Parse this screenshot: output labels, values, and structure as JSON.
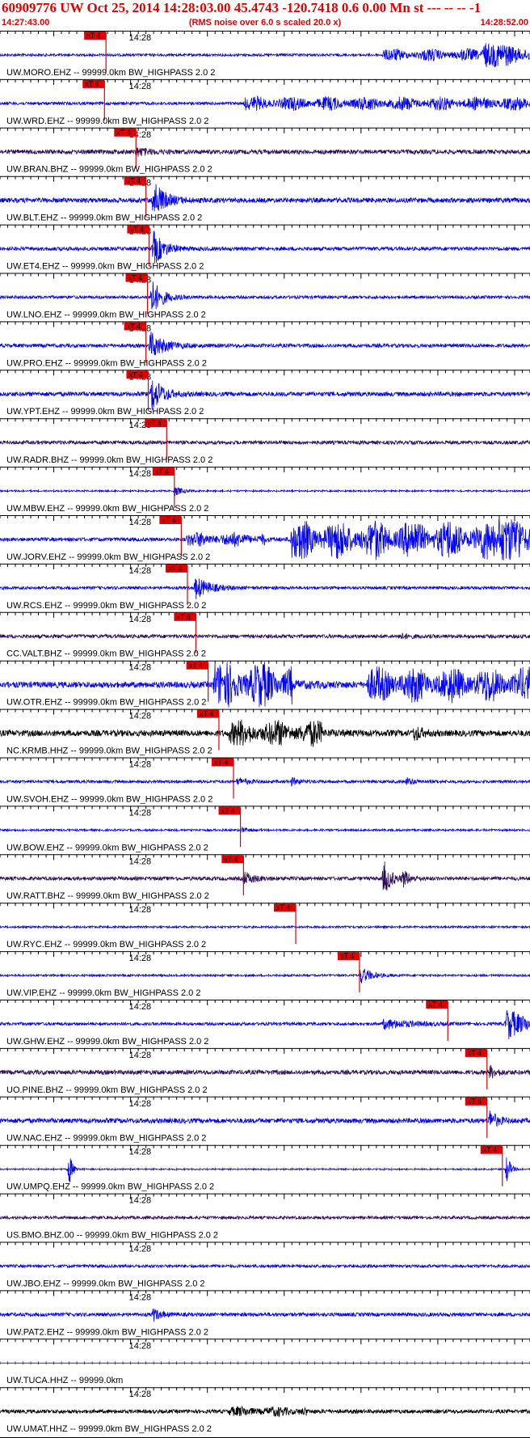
{
  "header": {
    "title": "60909776 UW Oct 25, 2014 14:28:03.00   45.4743 -120.7418  0.6 0.00 Mn st --- -- --  -1",
    "subtitle": "(RMS noise over 6.0 s scaled 20.0 x)",
    "time_start": "14:27:43.00",
    "time_end": "14:28:52.00"
  },
  "colors": {
    "header_text": "#e00000",
    "pick_flag": "#e00000",
    "trace_blue": "#0000ff",
    "trace_dark": "#2a0a5a",
    "trace_black": "#000000",
    "divider": "#000000"
  },
  "chart_data": {
    "type": "line",
    "title": "60909776 UW Oct 25, 2014 14:28:03.00   45.4743 -120.7418  0.6 0.00 Mn st --- -- --  -1",
    "subtitle": "(RMS noise over 6.0 s scaled 20.0 x)",
    "x_start": "14:27:43.00",
    "x_end": "14:28:52.00",
    "x_range_seconds": [
      0,
      69
    ],
    "major_tick_label": "14:28",
    "major_tick_second": 17,
    "grid": false,
    "pick_label": "xT 4",
    "series": [
      {
        "name": "UW.MORO.EHZ -- 99999.0km BW_HIGHPASS  2.0  2",
        "color": "#0000ff",
        "noise": 0.1,
        "pick": 13.8,
        "bursts": [
          {
            "t": 50,
            "amp": 0.45,
            "dur": 20
          },
          {
            "t": 63,
            "amp": 0.9,
            "dur": 8
          }
        ]
      },
      {
        "name": "UW.WRD.EHZ -- 99999.0km BW_HIGHPASS  2.0  2",
        "color": "#0000ff",
        "noise": 0.12,
        "pick": 13.6,
        "bursts": [
          {
            "t": 32,
            "amp": 0.5,
            "dur": 50
          }
        ]
      },
      {
        "name": "UW.BRAN.BHZ -- 99999.0km BW_HIGHPASS  2.0  2",
        "color": "#2a0a5a",
        "noise": 0.18,
        "pick": 17.7,
        "bursts": [
          {
            "t": 17.8,
            "amp": 0.3,
            "dur": 4
          }
        ]
      },
      {
        "name": "UW.BLT.EHZ -- 99999.0km BW_HIGHPASS  2.0  2",
        "color": "#0000ff",
        "noise": 0.2,
        "pick": 19.0,
        "bursts": [
          {
            "t": 20,
            "amp": 1.6,
            "dur": 3
          }
        ]
      },
      {
        "name": "UW.ET4.EHZ -- 99999.0km BW_HIGHPASS  2.0  2",
        "color": "#0000ff",
        "noise": 0.15,
        "pick": 19.4,
        "bursts": [
          {
            "t": 20,
            "amp": 1.4,
            "dur": 3
          }
        ]
      },
      {
        "name": "UW.LNO.EHZ -- 99999.0km BW_HIGHPASS  2.0  2",
        "color": "#0000ff",
        "noise": 0.12,
        "pick": 19.2,
        "bursts": [
          {
            "t": 19.7,
            "amp": 1.5,
            "dur": 3
          }
        ]
      },
      {
        "name": "UW.PRO.EHZ -- 99999.0km BW_HIGHPASS  2.0  2",
        "color": "#0000ff",
        "noise": 0.15,
        "pick": 19.0,
        "bursts": [
          {
            "t": 19.6,
            "amp": 1.1,
            "dur": 4
          }
        ]
      },
      {
        "name": "UW.YPT.EHZ -- 99999.0km BW_HIGHPASS  2.0  2",
        "color": "#0000ff",
        "noise": 0.18,
        "pick": 19.3,
        "bursts": [
          {
            "t": 19.8,
            "amp": 1.4,
            "dur": 3
          }
        ]
      },
      {
        "name": "UW.RADR.BHZ -- 99999.0km BW_HIGHPASS  2.0  2",
        "color": "#2a0a5a",
        "noise": 0.15,
        "pick": 21.7,
        "bursts": []
      },
      {
        "name": "UW.MBW.EHZ -- 99999.0km BW_HIGHPASS  2.0  2",
        "color": "#0000ff",
        "noise": 0.06,
        "pick": 22.7,
        "bursts": [
          {
            "t": 22.8,
            "amp": 0.4,
            "dur": 2
          }
        ]
      },
      {
        "name": "UW.JORV.EHZ -- 99999.0km BW_HIGHPASS  2.0  2",
        "color": "#0000ff",
        "noise": 0.15,
        "pick": 23.6,
        "bursts": [
          {
            "t": 24.5,
            "amp": 0.5,
            "dur": 10
          },
          {
            "t": 38,
            "amp": 1.6,
            "dur": 30
          },
          {
            "t": 65,
            "amp": 1.8,
            "dur": 8
          }
        ]
      },
      {
        "name": "UW.RCS.EHZ -- 99999.0km BW_HIGHPASS  2.0  2",
        "color": "#0000ff",
        "noise": 0.12,
        "pick": 24.4,
        "bursts": [
          {
            "t": 25.5,
            "amp": 0.9,
            "dur": 4
          }
        ]
      },
      {
        "name": "CC.VALT.BHZ -- 99999.0km BW_HIGHPASS  2.0  2",
        "color": "#2a0a5a",
        "noise": 0.15,
        "pick": 25.5,
        "bursts": [
          {
            "t": 52,
            "amp": 0.2,
            "dur": 3
          }
        ]
      },
      {
        "name": "UW.OTR.EHZ -- 99999.0km BW_HIGHPASS  2.0  2",
        "color": "#0000ff",
        "noise": 0.25,
        "pick": 27.1,
        "bursts": [
          {
            "t": 28,
            "amp": 1.8,
            "dur": 10
          },
          {
            "t": 48,
            "amp": 1.3,
            "dur": 21
          }
        ]
      },
      {
        "name": "NC.KRMB.HHZ -- 99999.0km BW_HIGHPASS  2.0  2",
        "color": "#000000",
        "noise": 0.25,
        "pick": 28.5,
        "bursts": [
          {
            "t": 30,
            "amp": 0.9,
            "dur": 12
          },
          {
            "t": 54,
            "amp": 0.6,
            "dur": 2
          }
        ]
      },
      {
        "name": "UW.SVOH.EHZ -- 99999.0km BW_HIGHPASS  2.0  2",
        "color": "#0000ff",
        "noise": 0.12,
        "pick": 30.4,
        "bursts": [
          {
            "t": 31,
            "amp": 0.3,
            "dur": 3
          },
          {
            "t": 38,
            "amp": 0.3,
            "dur": 2
          },
          {
            "t": 53,
            "amp": 0.3,
            "dur": 2
          }
        ]
      },
      {
        "name": "UW.BOW.EHZ -- 99999.0km BW_HIGHPASS  2.0  2",
        "color": "#0000ff",
        "noise": 0.08,
        "pick": 31.3,
        "bursts": [
          {
            "t": 31.5,
            "amp": 0.2,
            "dur": 2
          }
        ]
      },
      {
        "name": "UW.RATT.BHZ -- 99999.0km BW_HIGHPASS  2.0  2",
        "color": "#2a0a5a",
        "noise": 0.15,
        "pick": 31.7,
        "bursts": [
          {
            "t": 31.8,
            "amp": 0.5,
            "dur": 3
          },
          {
            "t": 50,
            "amp": 1.4,
            "dur": 2
          },
          {
            "t": 52.5,
            "amp": 0.6,
            "dur": 2
          }
        ]
      },
      {
        "name": "UW.RYC.EHZ -- 99999.0km BW_HIGHPASS  2.0  2",
        "color": "#0000ff",
        "noise": 0.08,
        "pick": 38.5,
        "bursts": []
      },
      {
        "name": "UW.VIP.EHZ -- 99999.0km BW_HIGHPASS  2.0  2",
        "color": "#0000ff",
        "noise": 0.08,
        "pick": 46.8,
        "bursts": [
          {
            "t": 47,
            "amp": 0.7,
            "dur": 3
          }
        ]
      },
      {
        "name": "UW.GHW.EHZ -- 99999.0km BW_HIGHPASS  2.0  2",
        "color": "#0000ff",
        "noise": 0.12,
        "pick": 58.3,
        "bursts": [
          {
            "t": 50,
            "amp": 0.4,
            "dur": 8
          },
          {
            "t": 66,
            "amp": 1.3,
            "dur": 6
          }
        ]
      },
      {
        "name": "UO.PINE.BHZ -- 99999.0km BW_HIGHPASS  2.0  2",
        "color": "#2a0a5a",
        "noise": 0.18,
        "pick": 63.4,
        "bursts": [
          {
            "t": 63.8,
            "amp": 0.5,
            "dur": 2
          }
        ]
      },
      {
        "name": "UW.NAC.EHZ -- 99999.0km BW_HIGHPASS  2.0  2",
        "color": "#0000ff",
        "noise": 0.2,
        "pick": 63.4,
        "bursts": [
          {
            "t": 63.8,
            "amp": 0.8,
            "dur": 2
          }
        ]
      },
      {
        "name": "UW.UMPQ.EHZ -- 99999.0km BW_HIGHPASS  2.0  2",
        "color": "#0000ff",
        "noise": 0.05,
        "pick": 65.4,
        "bursts": [
          {
            "t": 9,
            "amp": 1.4,
            "dur": 1
          },
          {
            "t": 66,
            "amp": 1.3,
            "dur": 1
          }
        ]
      },
      {
        "name": "US.BMO.BHZ.00 -- 99999.0km BW_HIGHPASS  2.0  2",
        "color": "#2a0a5a",
        "noise": 0.12,
        "pick": null,
        "bursts": []
      },
      {
        "name": "UW.JBO.EHZ -- 99999.0km BW_HIGHPASS  2.0  2",
        "color": "#0000ff",
        "noise": 0.12,
        "pick": null,
        "bursts": []
      },
      {
        "name": "UW.PAT2.EHZ -- 99999.0km BW_HIGHPASS  2.0  2",
        "color": "#0000ff",
        "noise": 0.15,
        "pick": null,
        "bursts": [
          {
            "t": 20,
            "amp": 0.5,
            "dur": 2
          }
        ]
      },
      {
        "name": "UW.TUCA.HHZ -- 99999.0km",
        "color": "#0000ff",
        "noise": 0.0,
        "pick": null,
        "bursts": []
      },
      {
        "name": "UW.UMAT.HHZ -- 99999.0km BW_HIGHPASS  2.0  2",
        "color": "#000000",
        "noise": 0.15,
        "pick": null,
        "bursts": [
          {
            "t": 30,
            "amp": 0.3,
            "dur": 10
          }
        ]
      }
    ]
  }
}
